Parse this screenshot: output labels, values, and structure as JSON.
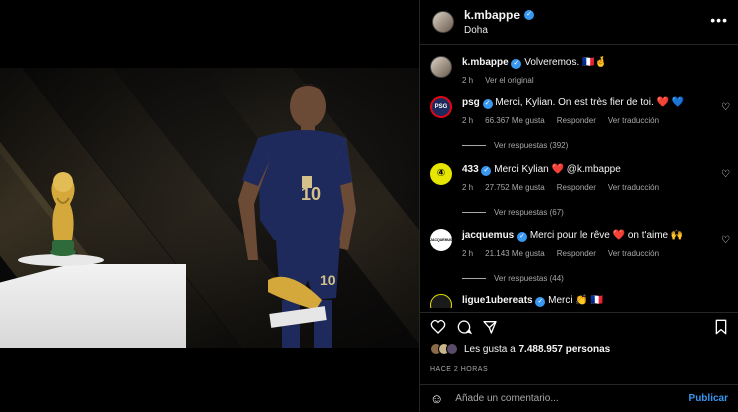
{
  "post": {
    "username": "k.mbappe",
    "location": "Doha",
    "caption": "Volveremos. 🇫🇷🤞",
    "caption_time": "2 h",
    "see_original": "Ver el original",
    "more_icon": "•••"
  },
  "comments": [
    {
      "username": "psg",
      "text": "Merci, Kylian. On est très fier de toi. ❤️ 💙",
      "time": "2 h",
      "likes": "66.367 Me gusta",
      "reply": "Responder",
      "translate": "Ver traducción",
      "replies": "Ver respuestas (392)"
    },
    {
      "username": "433",
      "text": "Merci Kylian ❤️ @k.mbappe",
      "time": "2 h",
      "likes": "27.752 Me gusta",
      "reply": "Responder",
      "translate": "Ver traducción",
      "replies": "Ver respuestas (67)"
    },
    {
      "username": "jacquemus",
      "text": "Merci pour le rêve ❤️ on t'aime 🙌",
      "time": "2 h",
      "likes": "21.143 Me gusta",
      "reply": "Responder",
      "translate": "Ver traducción",
      "replies": "Ver respuestas (44)"
    },
    {
      "username": "ligue1ubereats",
      "text": "Merci 👏 🇫🇷"
    }
  ],
  "engagement": {
    "likes_prefix": "Les gusta a ",
    "likes_count": "7.488.957 personas",
    "time_ago": "HACE 2 HORAS"
  },
  "composer": {
    "placeholder": "Añade un comentario...",
    "publish": "Publicar"
  },
  "icons": [
    "heart-icon",
    "comment-icon",
    "share-icon",
    "bookmark-icon",
    "emoji-icon",
    "verified-icon",
    "more-icon"
  ],
  "colors": {
    "background": "#000000",
    "verified": "#3897f0",
    "muted_text": "#a8a8a8",
    "divider": "#262626",
    "heart": "#ed4956",
    "trophy_gold": "#d4a83a",
    "jersey_navy": "#1f2a5c"
  }
}
